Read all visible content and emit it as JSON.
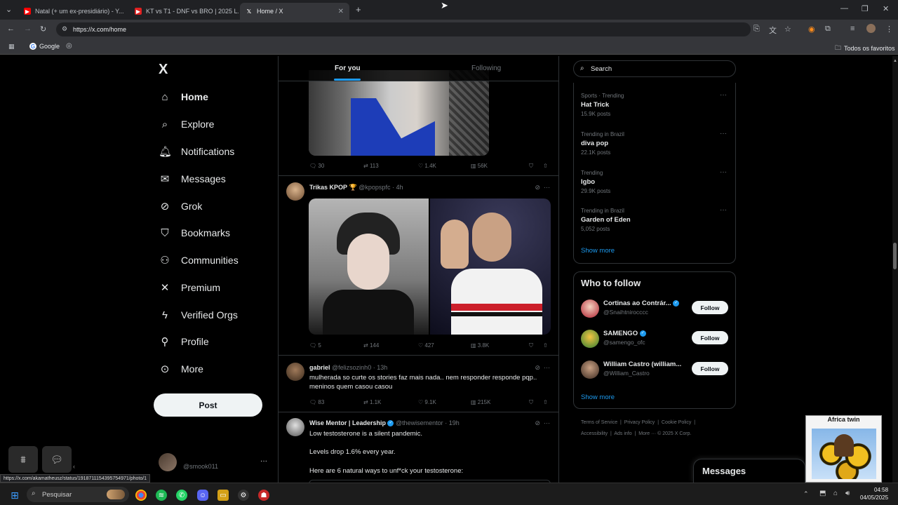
{
  "browser": {
    "tabs": [
      {
        "label": "Natal (+ um ex-presidiário) - Y..."
      },
      {
        "label": "KT vs T1 - DNF vs BRO | 2025 L..."
      },
      {
        "label": "Home / X"
      }
    ],
    "url": "https://x.com/home",
    "bookmarks": {
      "google": "Google",
      "all_bookmarks": "Todos os favoritos"
    },
    "status_url": "https://x.com/akamatheusz/status/1918711154395754971/photo/1"
  },
  "sidebar": {
    "logo": "X",
    "items": [
      {
        "label": "Home",
        "icon": "home-icon"
      },
      {
        "label": "Explore",
        "icon": "search-icon"
      },
      {
        "label": "Notifications",
        "icon": "bell-icon"
      },
      {
        "label": "Messages",
        "icon": "envelope-icon"
      },
      {
        "label": "Grok",
        "icon": "grok-icon"
      },
      {
        "label": "Bookmarks",
        "icon": "bookmark-icon"
      },
      {
        "label": "Communities",
        "icon": "people-icon"
      },
      {
        "label": "Premium",
        "icon": "x-icon"
      },
      {
        "label": "Verified Orgs",
        "icon": "lightning-icon"
      },
      {
        "label": "Profile",
        "icon": "person-icon"
      },
      {
        "label": "More",
        "icon": "more-circle-icon"
      }
    ],
    "post_label": "Post",
    "account_handle": "@smook011"
  },
  "feed": {
    "tabs": [
      "For you",
      "Following"
    ],
    "tweets": [
      {
        "replies": "30",
        "reposts": "113",
        "likes": "1.4K",
        "views": "56K"
      },
      {
        "name": "Trikas KPOP",
        "badge": "🏆",
        "handle": "@kpopspfc",
        "time": "4h",
        "replies": "5",
        "reposts": "144",
        "likes": "427",
        "views": "3.8K"
      },
      {
        "name": "gabriel",
        "handle": "@felizsozinh0",
        "time": "13h",
        "text": "mulherada so curte os stories faz mais nada.. nem responder responde pqp.. meninos quem casou casou",
        "replies": "83",
        "reposts": "1.1K",
        "likes": "9.1K",
        "views": "215K"
      },
      {
        "name": "Wise Mentor | Leadership",
        "handle": "@thewisementor",
        "time": "19h",
        "lines": [
          "Low testosterone is a silent pandemic.",
          "Levels drop 1.6% every year.",
          "Here are 6 natural ways to unf*ck your testosterone:"
        ]
      }
    ]
  },
  "right": {
    "search_placeholder": "Search",
    "trends": [
      {
        "context": "Sports · Trending",
        "name": "Hat Trick",
        "posts": "15.9K posts"
      },
      {
        "context": "Trending in Brazil",
        "name": "diva pop",
        "posts": "22.1K posts"
      },
      {
        "context": "Trending",
        "name": "Igbo",
        "posts": "29.9K posts"
      },
      {
        "context": "Trending in Brazil",
        "name": "Garden of Eden",
        "posts": "5,052 posts"
      }
    ],
    "show_more": "Show more",
    "who_to_follow": "Who to follow",
    "follow_label": "Follow",
    "suggestions": [
      {
        "name": "Cortinas ao Contrár...",
        "handle": "@Snaihtnirocccc"
      },
      {
        "name": "SAMENGO",
        "handle": "@samengo_ofc"
      },
      {
        "name": "William Castro (william...",
        "handle": "@William_Castro"
      }
    ],
    "footer": {
      "line1": [
        "Terms of Service",
        "Privacy Policy",
        "Cookie Policy"
      ],
      "line2": [
        "Accessibility",
        "Ads info",
        "More ···",
        "© 2025 X Corp."
      ]
    }
  },
  "messages_drawer": "Messages",
  "pip_title": "Africa twin",
  "taskbar": {
    "search": "Pesquisar",
    "time": "04:58",
    "date": "04/05/2025"
  },
  "colors": {
    "accent": "#1d9bf0",
    "background": "#000000",
    "border": "#2f3336",
    "muted": "#71767b"
  }
}
